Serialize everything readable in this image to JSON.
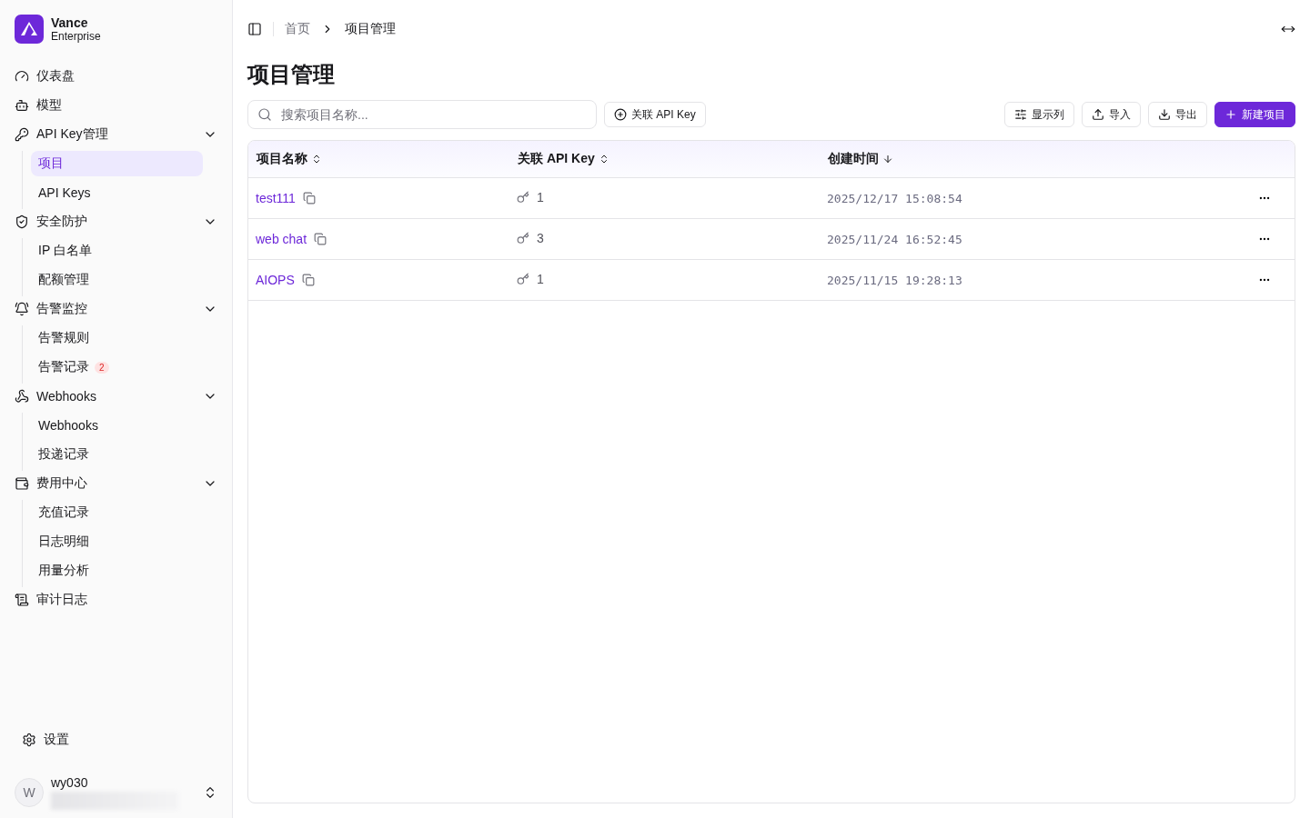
{
  "brand": {
    "name": "Vance",
    "plan": "Enterprise"
  },
  "nav": [
    {
      "label": "仪表盘",
      "selected": false
    },
    {
      "label": "模型",
      "selected": false
    },
    {
      "label": "API Key管理",
      "selected": false,
      "expanded": true,
      "children": [
        {
          "label": "项目",
          "selected": true
        },
        {
          "label": "API Keys",
          "selected": false
        }
      ]
    },
    {
      "label": "安全防护",
      "selected": false,
      "expanded": true,
      "children": [
        {
          "label": "IP 白名单",
          "selected": false
        },
        {
          "label": "配额管理",
          "selected": false
        }
      ]
    },
    {
      "label": "告警监控",
      "selected": false,
      "expanded": true,
      "children": [
        {
          "label": "告警规则",
          "selected": false
        },
        {
          "label": "告警记录",
          "selected": false,
          "badge": "2"
        }
      ]
    },
    {
      "label": "Webhooks",
      "selected": false,
      "expanded": true,
      "children": [
        {
          "label": "Webhooks",
          "selected": false
        },
        {
          "label": "投递记录",
          "selected": false
        }
      ]
    },
    {
      "label": "费用中心",
      "selected": false,
      "expanded": true,
      "children": [
        {
          "label": "充值记录",
          "selected": false
        },
        {
          "label": "日志明细",
          "selected": false
        },
        {
          "label": "用量分析",
          "selected": false
        }
      ]
    },
    {
      "label": "审计日志",
      "selected": false
    }
  ],
  "settings": "设置",
  "user": {
    "initial": "W",
    "name": "wy030"
  },
  "breadcrumb": [
    "首页",
    "项目管理"
  ],
  "page_title": "项目管理",
  "search": {
    "placeholder": "搜索项目名称..."
  },
  "link_button": "关联 API Key",
  "toolbar": [
    {
      "label": "显示列",
      "kind": "columns"
    },
    {
      "label": "导入",
      "kind": "import"
    },
    {
      "label": "导出",
      "kind": "export"
    },
    {
      "label": "新建项目",
      "kind": "primary"
    }
  ],
  "table": {
    "columns": [
      {
        "label": "项目名称",
        "sorted": false
      },
      {
        "label": "关联 API Key",
        "sorted": false
      },
      {
        "label": "创建时间",
        "sorted": true
      }
    ],
    "rows": [
      {
        "name": "test111",
        "keys": "1",
        "created": "2025/12/17 15:08:54"
      },
      {
        "name": "web chat",
        "keys": "3",
        "created": "2025/11/24 16:52:45"
      },
      {
        "name": "AIOPS",
        "keys": "1",
        "created": "2025/11/15 19:28:13"
      }
    ]
  }
}
